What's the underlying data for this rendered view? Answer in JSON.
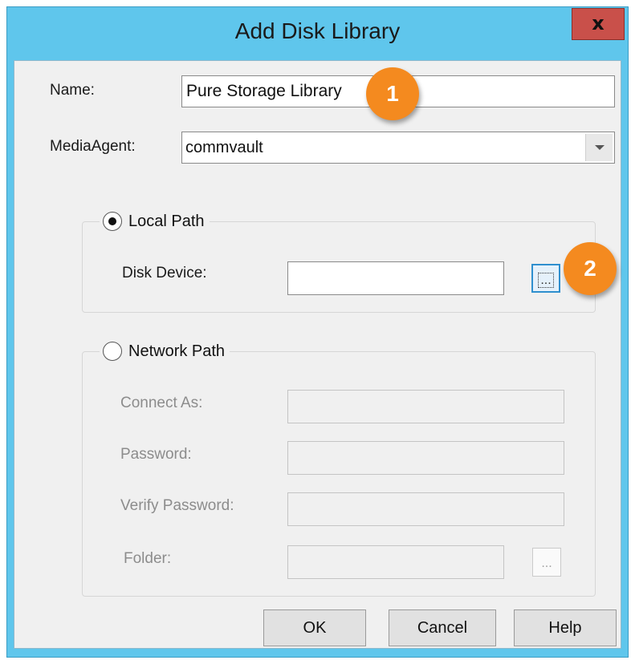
{
  "window": {
    "title": "Add Disk Library",
    "close_label": "x"
  },
  "form": {
    "name_label": "Name:",
    "name_value": "Pure Storage Library",
    "mediaagent_label": "MediaAgent:",
    "mediaagent_value": "commvault"
  },
  "local_path": {
    "label": "Local Path",
    "selected": true,
    "disk_device_label": "Disk Device:",
    "disk_device_value": "",
    "browse_label": "..."
  },
  "network_path": {
    "label": "Network Path",
    "selected": false,
    "connect_as_label": "Connect As:",
    "password_label": "Password:",
    "verify_password_label": "Verify Password:",
    "folder_label": "Folder:",
    "browse_label": "..."
  },
  "callouts": [
    "1",
    "2"
  ],
  "buttons": {
    "ok": "OK",
    "cancel": "Cancel",
    "help": "Help"
  },
  "colors": {
    "titlebar": "#5fc6ec",
    "close": "#c9504a",
    "callout": "#f48a1f",
    "focus": "#2f8fce"
  }
}
